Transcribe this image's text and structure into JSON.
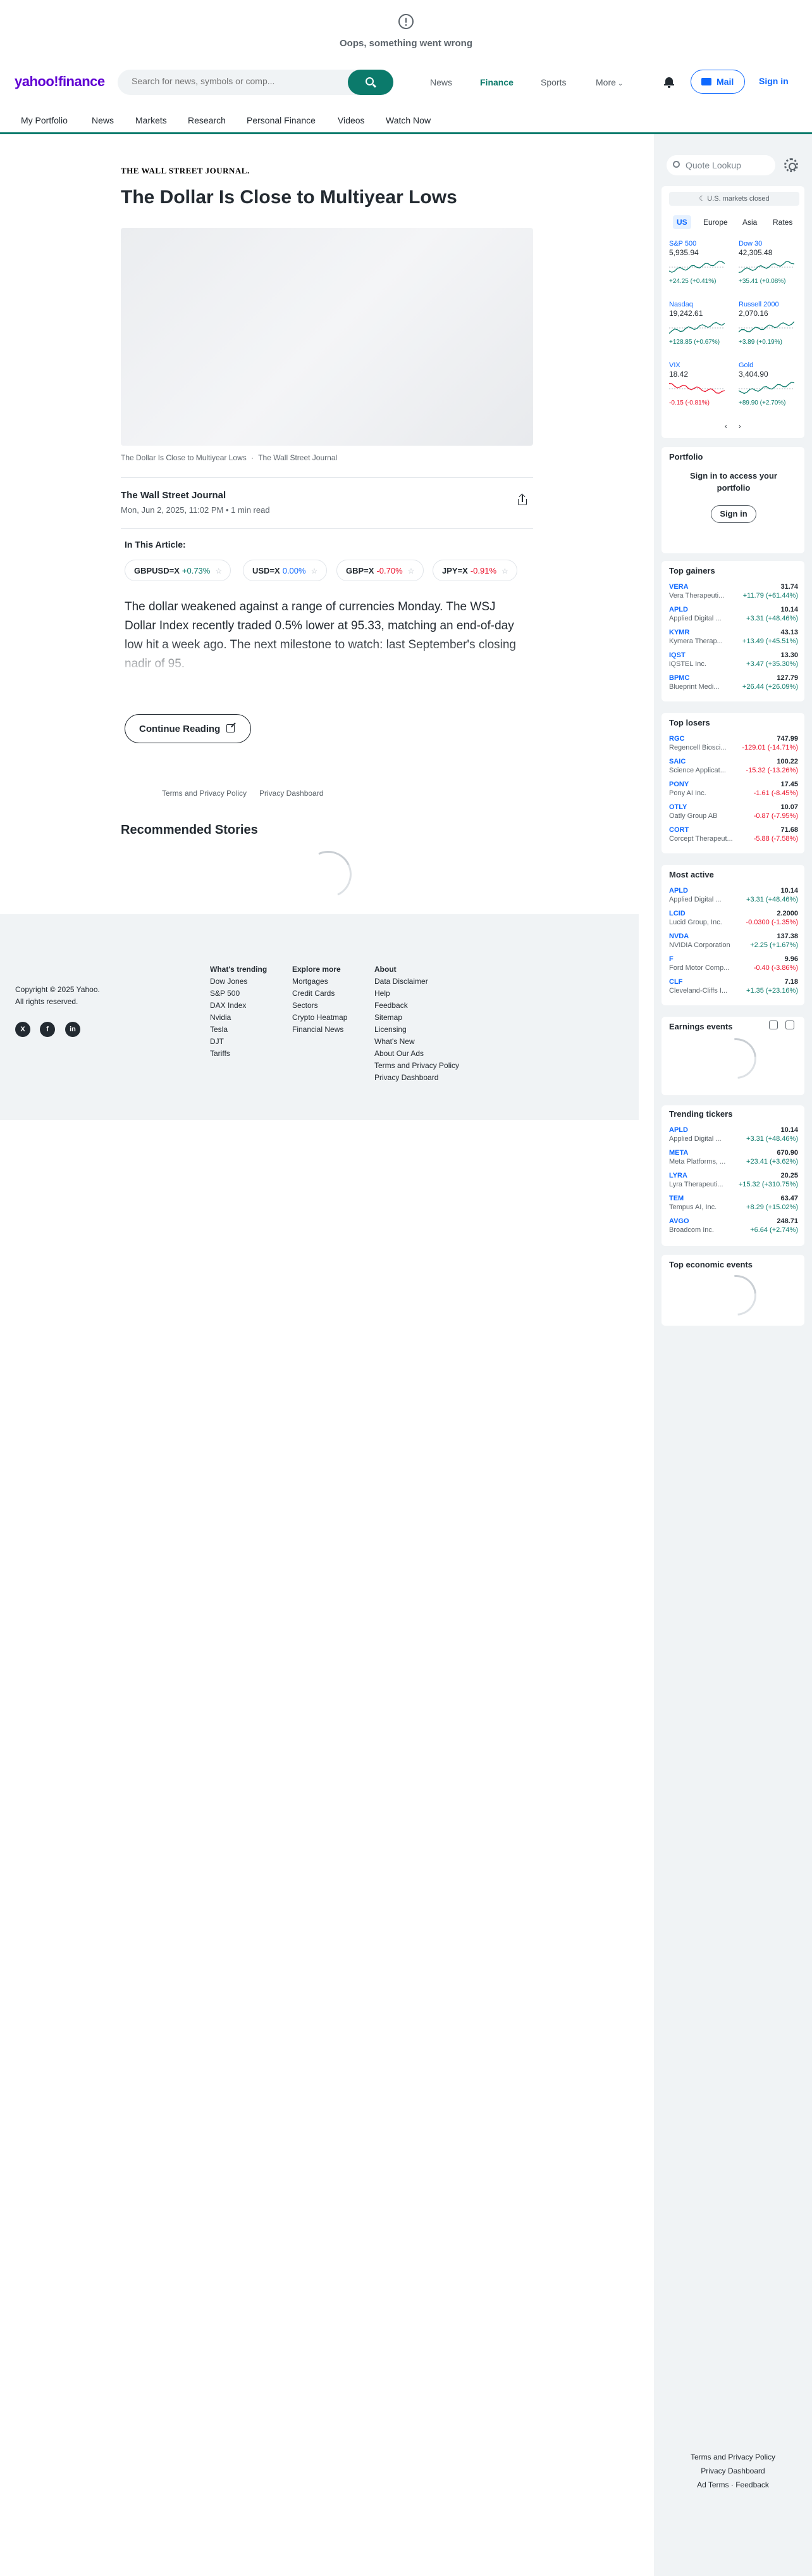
{
  "error": {
    "message": "Oops, something went wrong"
  },
  "header": {
    "logo": "yahoo!finance",
    "search_placeholder": "Search for news, symbols or comp...",
    "nav": [
      "News",
      "Finance",
      "Sports",
      "More"
    ],
    "mail": "Mail",
    "signin": "Sign in"
  },
  "subnav": [
    "My Portfolio",
    "News",
    "Markets",
    "Research",
    "Personal Finance",
    "Videos",
    "Watch Now"
  ],
  "article": {
    "source_logo": "THE WALL STREET JOURNAL.",
    "headline": "The Dollar Is Close to Multiyear Lows",
    "caption": "The Dollar Is Close to Multiyear Lows",
    "caption_source": "The Wall Street Journal",
    "byline_source": "The Wall Street Journal",
    "byline_date": "Mon, Jun 2, 2025, 11:02 PM • 1 min read",
    "in_this_article": "In This Article:",
    "tickers": [
      {
        "symbol": "GBPUSD=X",
        "change": "+0.73%",
        "dir": "up"
      },
      {
        "symbol": "USD=X",
        "change": "0.00%",
        "dir": "flat"
      },
      {
        "symbol": "GBP=X",
        "change": "-0.70%",
        "dir": "dn"
      },
      {
        "symbol": "JPY=X",
        "change": "-0.91%",
        "dir": "dn"
      }
    ],
    "body": "The dollar weakened against a range of currencies Monday. The WSJ Dollar Index recently traded 0.5% lower at 95.33, matching an end-of-day low hit a week ago. The next milestone to watch: last September's closing nadir of 95.",
    "continue": "Continue Reading",
    "links": [
      "Terms and Privacy Policy",
      "Privacy Dashboard"
    ],
    "recommended": "Recommended Stories"
  },
  "footer": {
    "copyright": "Copyright © 2025 Yahoo.",
    "rights": "All rights reserved.",
    "social": [
      "X",
      "f",
      "in"
    ],
    "cols": [
      {
        "title": "What's trending",
        "items": [
          "Dow Jones",
          "S&P 500",
          "DAX Index",
          "Nvidia",
          "Tesla",
          "DJT",
          "Tariffs"
        ]
      },
      {
        "title": "Explore more",
        "items": [
          "Mortgages",
          "Credit Cards",
          "Sectors",
          "Crypto Heatmap",
          "Financial News"
        ]
      },
      {
        "title": "About",
        "items": [
          "Data Disclaimer",
          "Help",
          "Feedback",
          "Sitemap",
          "Licensing",
          "What's New",
          "About Our Ads",
          "Terms and Privacy Policy",
          "Privacy Dashboard"
        ]
      }
    ]
  },
  "rail": {
    "quote_lookup": "Quote Lookup",
    "markets_closed": "U.S. markets closed",
    "tabs": [
      "US",
      "Europe",
      "Asia",
      "Rates"
    ],
    "markets": [
      {
        "name": "S&P 500",
        "value": "5,935.94",
        "change": "+24.25 (+0.41%)",
        "dir": "up",
        "col": 0
      },
      {
        "name": "Dow 30",
        "value": "42,305.48",
        "change": "+35.41 (+0.08%)",
        "dir": "up",
        "col": 1
      },
      {
        "name": "Nasdaq",
        "value": "19,242.61",
        "change": "+128.85 (+0.67%)",
        "dir": "up",
        "col": 0
      },
      {
        "name": "Russell 2000",
        "value": "2,070.16",
        "change": "+3.89 (+0.19%)",
        "dir": "up",
        "col": 1
      },
      {
        "name": "VIX",
        "value": "18.42",
        "change": "-0.15 (-0.81%)",
        "dir": "dn",
        "col": 0
      },
      {
        "name": "Gold",
        "value": "3,404.90",
        "change": "+89.90 (+2.70%)",
        "dir": "up",
        "col": 1
      }
    ],
    "portfolio": {
      "title": "Portfolio",
      "text": "Sign in to access your portfolio",
      "button": "Sign in"
    },
    "top_gainers": {
      "title": "Top gainers",
      "rows": [
        {
          "s": "VERA",
          "n": "Vera Therapeuti...",
          "p": "31.74",
          "c": "+11.79 (+61.44%)",
          "d": "up"
        },
        {
          "s": "APLD",
          "n": "Applied Digital ...",
          "p": "10.14",
          "c": "+3.31 (+48.46%)",
          "d": "up"
        },
        {
          "s": "KYMR",
          "n": "Kymera Therap...",
          "p": "43.13",
          "c": "+13.49 (+45.51%)",
          "d": "up"
        },
        {
          "s": "IQST",
          "n": "iQSTEL Inc.",
          "p": "13.30",
          "c": "+3.47 (+35.30%)",
          "d": "up"
        },
        {
          "s": "BPMC",
          "n": "Blueprint Medi...",
          "p": "127.79",
          "c": "+26.44 (+26.09%)",
          "d": "up"
        }
      ]
    },
    "top_losers": {
      "title": "Top losers",
      "rows": [
        {
          "s": "RGC",
          "n": "Regencell Biosci...",
          "p": "747.99",
          "c": "-129.01 (-14.71%)",
          "d": "dn"
        },
        {
          "s": "SAIC",
          "n": "Science Applicat...",
          "p": "100.22",
          "c": "-15.32 (-13.26%)",
          "d": "dn"
        },
        {
          "s": "PONY",
          "n": "Pony AI Inc.",
          "p": "17.45",
          "c": "-1.61 (-8.45%)",
          "d": "dn"
        },
        {
          "s": "OTLY",
          "n": "Oatly Group AB",
          "p": "10.07",
          "c": "-0.87 (-7.95%)",
          "d": "dn"
        },
        {
          "s": "CORT",
          "n": "Corcept Therapeut...",
          "p": "71.68",
          "c": "-5.88 (-7.58%)",
          "d": "dn"
        }
      ]
    },
    "most_active": {
      "title": "Most active",
      "rows": [
        {
          "s": "APLD",
          "n": "Applied Digital ...",
          "p": "10.14",
          "c": "+3.31 (+48.46%)",
          "d": "up"
        },
        {
          "s": "LCID",
          "n": "Lucid Group, Inc.",
          "p": "2.2000",
          "c": "-0.0300 (-1.35%)",
          "d": "dn"
        },
        {
          "s": "NVDA",
          "n": "NVIDIA Corporation",
          "p": "137.38",
          "c": "+2.25 (+1.67%)",
          "d": "up"
        },
        {
          "s": "F",
          "n": "Ford Motor Comp...",
          "p": "9.96",
          "c": "-0.40 (-3.86%)",
          "d": "dn"
        },
        {
          "s": "CLF",
          "n": "Cleveland-Cliffs I...",
          "p": "7.18",
          "c": "+1.35 (+23.16%)",
          "d": "up"
        }
      ]
    },
    "earnings": {
      "title": "Earnings events"
    },
    "trending": {
      "title": "Trending tickers",
      "rows": [
        {
          "s": "APLD",
          "n": "Applied Digital ...",
          "p": "10.14",
          "c": "+3.31 (+48.46%)",
          "d": "up"
        },
        {
          "s": "META",
          "n": "Meta Platforms, ...",
          "p": "670.90",
          "c": "+23.41 (+3.62%)",
          "d": "up"
        },
        {
          "s": "LYRA",
          "n": "Lyra Therapeuti...",
          "p": "20.25",
          "c": "+15.32 (+310.75%)",
          "d": "up"
        },
        {
          "s": "TEM",
          "n": "Tempus AI, Inc.",
          "p": "63.47",
          "c": "+8.29 (+15.02%)",
          "d": "up"
        },
        {
          "s": "AVGO",
          "n": "Broadcom Inc.",
          "p": "248.71",
          "c": "+6.64 (+2.74%)",
          "d": "up"
        }
      ]
    },
    "economic": {
      "title": "Top economic events"
    },
    "footer_links": [
      "Terms and Privacy Policy",
      "Privacy Dashboard",
      "Ad Terms",
      "Feedback"
    ]
  }
}
